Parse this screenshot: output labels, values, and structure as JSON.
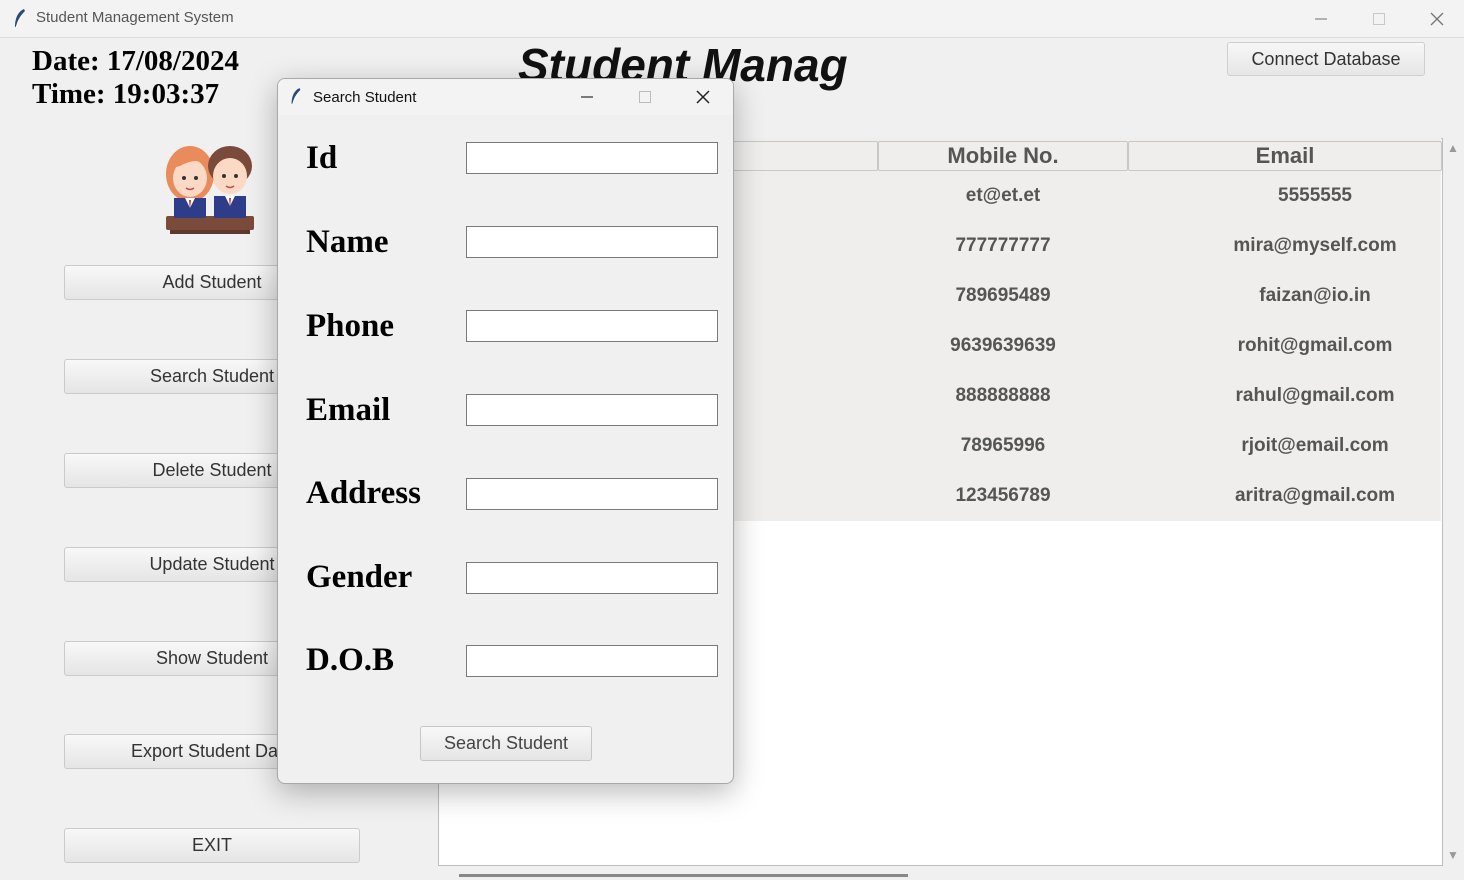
{
  "window": {
    "title": "Student Management System"
  },
  "header": {
    "date": "Date: 17/08/2024",
    "time": "Time: 19:03:37",
    "title": "Student Manag",
    "connect_label": "Connect Database"
  },
  "sidebar": {
    "buttons": [
      "Add Student",
      "Search Student",
      "Delete Student",
      "Update Student",
      "Show Student",
      "Export Student Data",
      "EXIT"
    ]
  },
  "table": {
    "columns": [
      "Mobile No.",
      "Email"
    ],
    "rows": [
      [
        "et@et.et",
        "5555555"
      ],
      [
        "777777777",
        "mira@myself.com"
      ],
      [
        "789695489",
        "faizan@io.in"
      ],
      [
        "9639639639",
        "rohit@gmail.com"
      ],
      [
        "888888888",
        "rahul@gmail.com"
      ],
      [
        "78965996",
        "rjoit@email.com"
      ],
      [
        "123456789",
        "aritra@gmail.com"
      ]
    ]
  },
  "dialog": {
    "title": "Search Student",
    "fields": [
      {
        "label": "Id",
        "value": ""
      },
      {
        "label": "Name",
        "value": ""
      },
      {
        "label": "Phone",
        "value": ""
      },
      {
        "label": "Email",
        "value": ""
      },
      {
        "label": "Address",
        "value": ""
      },
      {
        "label": "Gender",
        "value": ""
      },
      {
        "label": "D.O.B",
        "value": ""
      }
    ],
    "search_label": "Search Student"
  },
  "icons": {
    "app": "feather-icon",
    "minimize": "minimize-icon",
    "maximize": "maximize-icon",
    "close": "close-icon",
    "avatar": "students-avatar-icon"
  }
}
